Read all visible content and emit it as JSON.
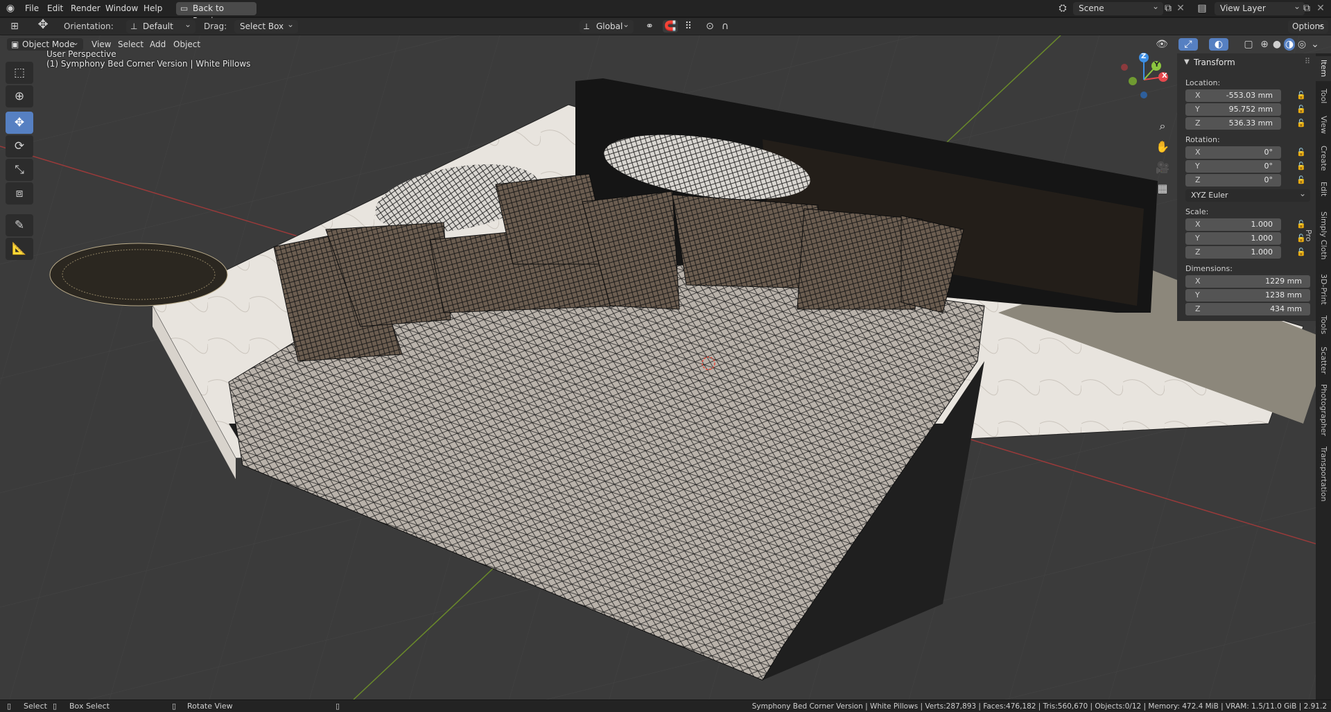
{
  "menubar": {
    "items": [
      "File",
      "Edit",
      "Render",
      "Window",
      "Help"
    ],
    "back_button": "Back to Previous",
    "scene_label": "Scene",
    "view_layer_label": "View Layer"
  },
  "tool_header": {
    "orientation_label": "Orientation:",
    "orientation_value": "Default",
    "drag_label": "Drag:",
    "drag_value": "Select Box",
    "transform_space": "Global",
    "options_label": "Options"
  },
  "view_header": {
    "mode": "Object Mode",
    "menus": [
      "View",
      "Select",
      "Add",
      "Object"
    ]
  },
  "viewport": {
    "perspective": "User Perspective",
    "object_info": "(1) Symphony Bed Corner Version | White Pillows",
    "gizmo_axes": {
      "x": "X",
      "y": "Y",
      "z": "Z"
    }
  },
  "transform_panel": {
    "title": "Transform",
    "location_label": "Location:",
    "location": {
      "x": "-553.03 mm",
      "y": "95.752 mm",
      "z": "536.33 mm"
    },
    "rotation_label": "Rotation:",
    "rotation": {
      "x": "0°",
      "y": "0°",
      "z": "0°"
    },
    "rotation_mode": "XYZ Euler",
    "scale_label": "Scale:",
    "scale": {
      "x": "1.000",
      "y": "1.000",
      "z": "1.000"
    },
    "dimensions_label": "Dimensions:",
    "dimensions": {
      "x": "1229 mm",
      "y": "1238 mm",
      "z": "434 mm"
    },
    "axis_labels": {
      "x": "X",
      "y": "Y",
      "z": "Z"
    }
  },
  "sidebar_tabs": [
    "Item",
    "Tool",
    "View",
    "Create",
    "Edit",
    "Simply Cloth Pro",
    "3D-Print",
    "Tools",
    "Scatter",
    "Photographer",
    "Transportation"
  ],
  "status_bar": {
    "select": "Select",
    "box_select": "Box Select",
    "rotate_view": "Rotate View",
    "stats": "Symphony Bed Corner Version | White Pillows | Verts:287,893 | Faces:476,182 | Tris:560,670 | Objects:0/12 | Memory: 472.4 MiB | VRAM: 1.5/11.0 GiB | 2.91.2"
  },
  "colors": {
    "accent": "#5680c2",
    "axis_x": "#e5484d",
    "axis_y": "#8cc63f",
    "axis_z": "#3d8fe5"
  }
}
